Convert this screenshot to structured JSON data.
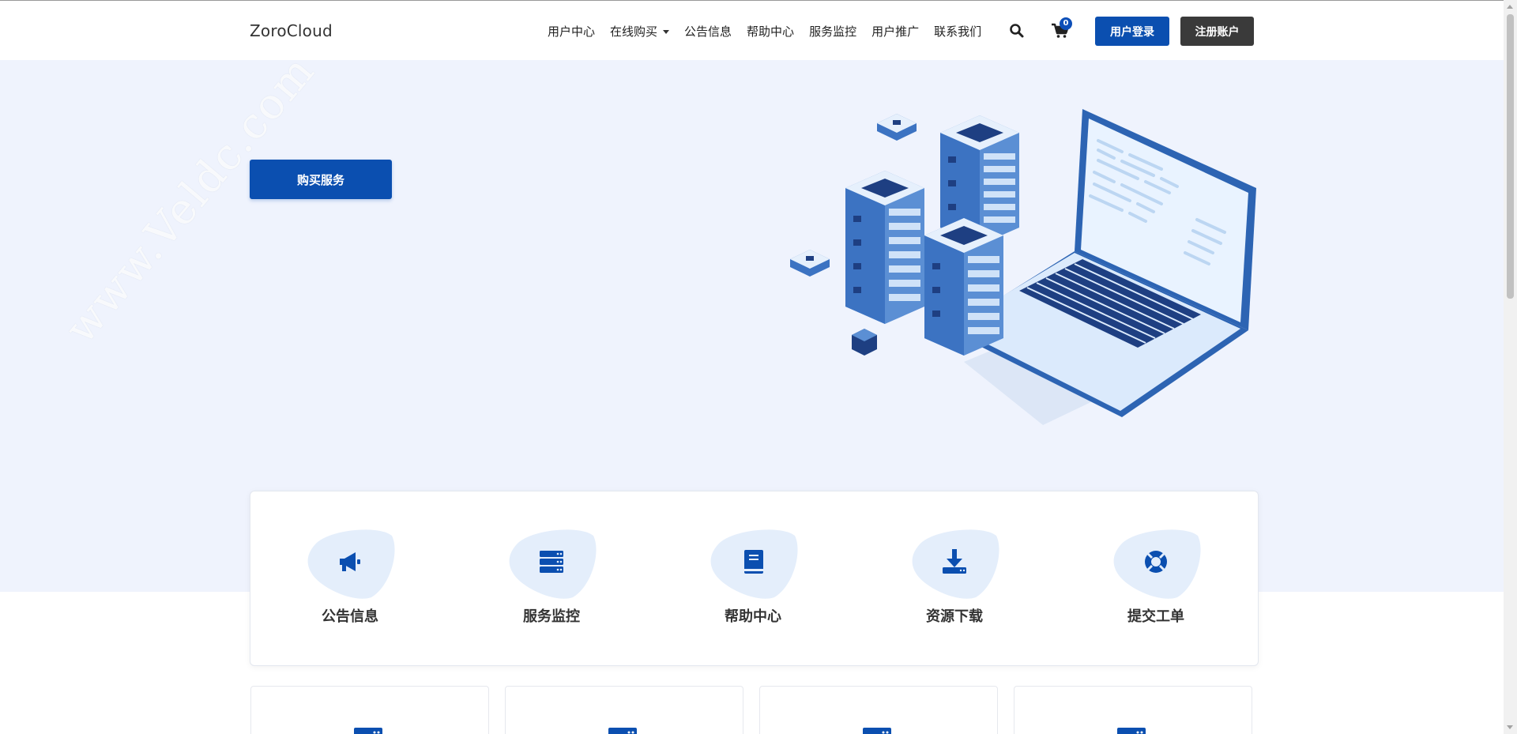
{
  "header": {
    "brand": "ZoroCloud",
    "nav": [
      {
        "label": "用户中心"
      },
      {
        "label": "在线购买",
        "has_dropdown": true
      },
      {
        "label": "公告信息"
      },
      {
        "label": "帮助中心"
      },
      {
        "label": "服务监控"
      },
      {
        "label": "用户推广"
      },
      {
        "label": "联系我们"
      }
    ],
    "search_icon": "search-icon",
    "cart_icon": "cart-icon",
    "cart_count": "0",
    "login_label": "用户登录",
    "register_label": "注册账户"
  },
  "hero": {
    "buy_button": "购买服务",
    "illustration": "servers-and-laptop-illustration",
    "watermark": "www.Veldc.com"
  },
  "features": [
    {
      "label": "公告信息",
      "icon": "megaphone-icon"
    },
    {
      "label": "服务监控",
      "icon": "server-icon"
    },
    {
      "label": "帮助中心",
      "icon": "book-icon"
    },
    {
      "label": "资源下载",
      "icon": "download-icon"
    },
    {
      "label": "提交工单",
      "icon": "lifebuoy-icon"
    }
  ],
  "colors": {
    "primary": "#0b4fb0",
    "dark_button": "#3a3a3a",
    "hero_bg": "#eff3fd",
    "blob": "#e4eefb"
  }
}
